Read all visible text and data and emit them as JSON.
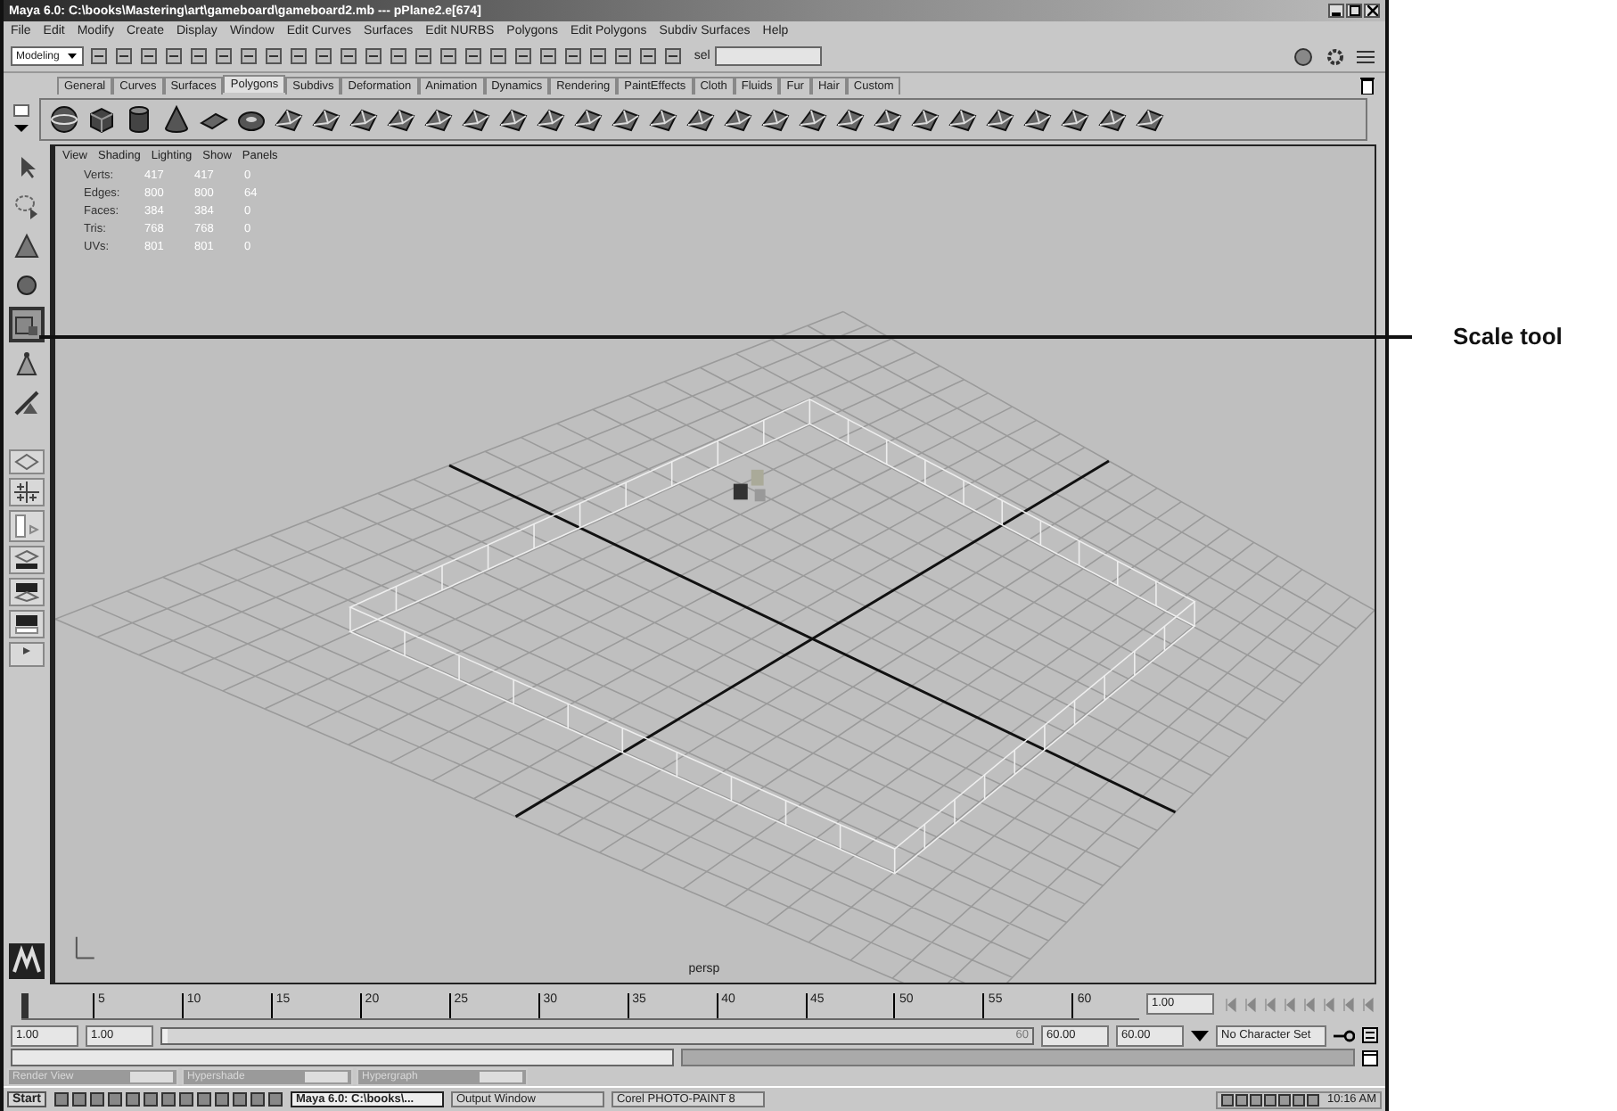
{
  "window": {
    "title": "Maya 6.0: C:\\books\\Mastering\\art\\gameboard\\gameboard2.mb  ---  pPlane2.e[674]"
  },
  "menu": [
    "File",
    "Edit",
    "Modify",
    "Create",
    "Display",
    "Window",
    "Edit Curves",
    "Surfaces",
    "Edit NURBS",
    "Polygons",
    "Edit Polygons",
    "Subdiv Surfaces",
    "Help"
  ],
  "status_line": {
    "menu_set": "Modeling",
    "selection_label": "sel"
  },
  "shelf_tabs": [
    {
      "label": "General",
      "selected": false
    },
    {
      "label": "Curves",
      "selected": false
    },
    {
      "label": "Surfaces",
      "selected": false
    },
    {
      "label": "Polygons",
      "selected": true
    },
    {
      "label": "Subdivs",
      "selected": false
    },
    {
      "label": "Deformation",
      "selected": false
    },
    {
      "label": "Animation",
      "selected": false
    },
    {
      "label": "Dynamics",
      "selected": false
    },
    {
      "label": "Rendering",
      "selected": false
    },
    {
      "label": "PaintEffects",
      "selected": false
    },
    {
      "label": "Cloth",
      "selected": false
    },
    {
      "label": "Fluids",
      "selected": false
    },
    {
      "label": "Fur",
      "selected": false
    },
    {
      "label": "Hair",
      "selected": false
    },
    {
      "label": "Custom",
      "selected": false
    }
  ],
  "toolbox": [
    {
      "kind": "select",
      "selected": false
    },
    {
      "kind": "lasso",
      "selected": false
    },
    {
      "kind": "paint",
      "selected": false
    },
    {
      "kind": "move",
      "selected": false
    },
    {
      "kind": "scale",
      "selected": true
    },
    {
      "kind": "rotate",
      "selected": false
    },
    {
      "kind": "manipulator",
      "selected": false
    }
  ],
  "viewport": {
    "menu": [
      "View",
      "Shading",
      "Lighting",
      "Show",
      "Panels"
    ],
    "stats": [
      {
        "label": "Verts:",
        "values": [
          "417",
          "417",
          "0"
        ]
      },
      {
        "label": "Edges:",
        "values": [
          "800",
          "800",
          "64"
        ]
      },
      {
        "label": "Faces:",
        "values": [
          "384",
          "384",
          "0"
        ]
      },
      {
        "label": "Tris:",
        "values": [
          "768",
          "768",
          "0"
        ]
      },
      {
        "label": "UVs:",
        "values": [
          "801",
          "801",
          "0"
        ]
      }
    ],
    "camera": "persp"
  },
  "timeline": {
    "level": 0,
    "ticks": [
      "5",
      "10",
      "15",
      "20",
      "25",
      "30",
      "35",
      "40",
      "45",
      "50",
      "55",
      "60"
    ],
    "current_frame": "1.00"
  },
  "range": {
    "level": 1,
    "start": "1.00",
    "playback_start": "1.00",
    "slider_end": "60",
    "playback_end": "60.00",
    "end": "60.00",
    "character_set": "No Character Set"
  },
  "minimized_windows": [
    "Render View",
    "Hypershade",
    "Hypergraph"
  ],
  "taskbar": {
    "start": "Start",
    "tasks": [
      {
        "label": "Maya 6.0: C:\\books\\...",
        "selected": true
      },
      {
        "label": "Output Window",
        "selected": false
      },
      {
        "label": "Corel PHOTO-PAINT 8",
        "selected": false
      }
    ],
    "clock": "10:16 AM"
  },
  "callout": {
    "label": "Scale tool"
  }
}
